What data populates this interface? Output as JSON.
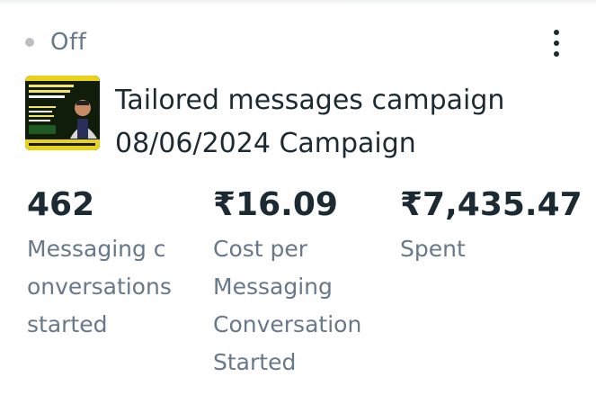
{
  "status": {
    "label": "Off",
    "dot_color": "#bcc0c4"
  },
  "more_icon": "more-vertical-icon",
  "campaign": {
    "title_line1": "Tailored messages campaign",
    "title_line2": "08/06/2024 Campaign",
    "thumbnail": "campaign-ad-thumbnail"
  },
  "metrics": [
    {
      "value": "462",
      "label": "Messaging c\nonversations\nstarted"
    },
    {
      "value": "₹16.09",
      "label": "Cost per\nMessaging\nConversation\nStarted"
    },
    {
      "value": "₹7,435.47",
      "label": "Spent"
    }
  ]
}
